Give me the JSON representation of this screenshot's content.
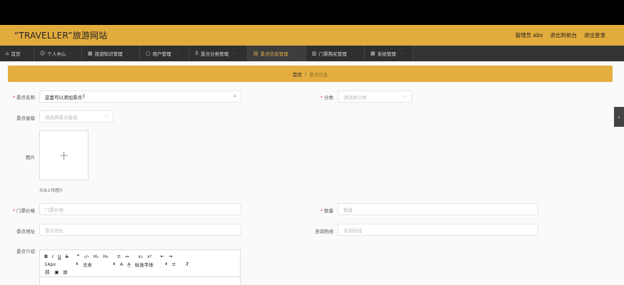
{
  "header": {
    "brand": "“TRAVELLER”旅游网站",
    "admin": "管理员 abo",
    "back_front": "退出到前台",
    "logout": "退出登录"
  },
  "nav": [
    {
      "icon": "home-icon",
      "glyph": "⌂",
      "label": "首页"
    },
    {
      "icon": "user-icon",
      "glyph": "☺",
      "label": "个人中心"
    },
    {
      "icon": "grid-icon",
      "glyph": "▦",
      "label": "旅游知识管理"
    },
    {
      "icon": "window-icon",
      "glyph": "▢",
      "label": "用户管理"
    },
    {
      "icon": "mic-icon",
      "glyph": "♁",
      "label": "景点分类管理"
    },
    {
      "icon": "list-icon",
      "glyph": "▤",
      "label": "景点信息管理"
    },
    {
      "icon": "chart-icon",
      "glyph": "▥",
      "label": "门票购买管理"
    },
    {
      "icon": "system-icon",
      "glyph": "▦",
      "label": "系统管理"
    }
  ],
  "breadcrumb": {
    "home": "首页",
    "sep": "/",
    "current": "景点信息"
  },
  "form": {
    "name_label": "景点名称",
    "name_value": "这里可以添加景点",
    "category_label": "分类",
    "category_placeholder": "请选择分类",
    "level_label": "景点星级",
    "level_placeholder": "请选择景点星级",
    "image_label": "图片",
    "upload_hint": "点击上传图片",
    "price_label": "门票价格",
    "price_placeholder": "门票价格",
    "quantity_label": "数量",
    "quantity_placeholder": "数量",
    "address_label": "景点地址",
    "address_placeholder": "景点地址",
    "hotline_label": "咨询热线",
    "hotline_placeholder": "咨询热线",
    "intro_label": "景点介绍"
  },
  "editor": {
    "bold": "B",
    "italic": "I",
    "underline": "U",
    "strike": "S",
    "quote": "❞",
    "code": "‹/›",
    "h1": "H₁",
    "h2": "H₂",
    "ol": "≡",
    "ul": "≔",
    "sub": "x₂",
    "sup": "x²",
    "outdent": "⇤",
    "indent": "⇥",
    "size": "14px",
    "font": "文本",
    "color": "A",
    "bg": "A̲",
    "family": "标准字体",
    "align": "≡",
    "clear": "T̸",
    "link": "🔗",
    "image": "▣",
    "video": "▤"
  },
  "side_toggle": "›",
  "colors": {
    "accent": "#e2ac3c",
    "nav_bg": "#2f2f2f"
  }
}
